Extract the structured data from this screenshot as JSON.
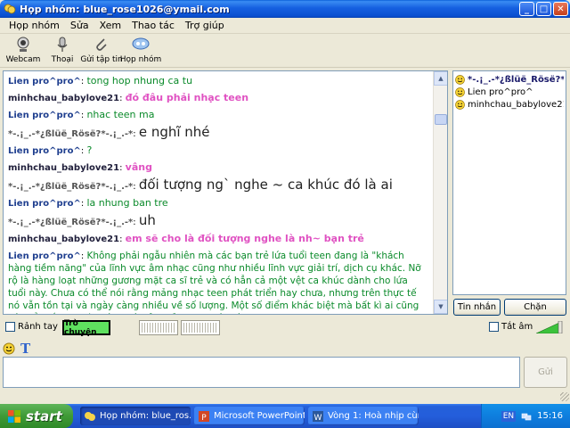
{
  "window": {
    "title_prefix": "Họp nhóm:",
    "title_email": "blue_rose1026@ymail.com"
  },
  "menu": [
    "Họp nhóm",
    "Sửa",
    "Xem",
    "Thao tác",
    "Trợ giúp"
  ],
  "toolbar": [
    {
      "label": "Webcam",
      "icon": "webcam-icon"
    },
    {
      "label": "Thoại",
      "icon": "microphone-icon"
    },
    {
      "label": "Gửi tập tin",
      "icon": "paperclip-icon"
    },
    {
      "label": "Họp nhóm",
      "icon": "conference-icon"
    }
  ],
  "chat": {
    "messages": [
      {
        "sender": "Lien pro^pro^",
        "text": "tong hop nhung ca tu",
        "style": "green",
        "skin": "lien"
      },
      {
        "sender": "minhchau_babylove21",
        "text": "đó đâu phải nhạc teen",
        "style": "pink",
        "skin": "minh"
      },
      {
        "sender": "Lien pro^pro^",
        "text": "nhac teen ma",
        "style": "green",
        "skin": "lien"
      },
      {
        "sender": "*-.¡_.-*¿ßlüë_Rösë?*-.¡_.-*",
        "text": "e nghĩ nhé",
        "style": "big",
        "skin": "rose"
      },
      {
        "sender": "Lien pro^pro^",
        "text": "?",
        "style": "green",
        "skin": "lien"
      },
      {
        "sender": "minhchau_babylove21",
        "text": "vâng",
        "style": "pink",
        "skin": "minh"
      },
      {
        "sender": "*-.¡_.-*¿ßlüë_Rösë?*-.¡_.-*",
        "text": "đối tượng ng` nghe ~ ca khúc đó là ai",
        "style": "big",
        "skin": "rose"
      },
      {
        "sender": "Lien pro^pro^",
        "text": "la nhung ban tre",
        "style": "green",
        "skin": "lien"
      },
      {
        "sender": "*-.¡_.-*¿ßlüë_Rösë?*-.¡_.-*",
        "text": "uh",
        "style": "big",
        "skin": "rose"
      },
      {
        "sender": "minhchau_babylove21",
        "text": "em sẽ cho là đối tượng nghe là nh~ bạn trẻ",
        "style": "pink",
        "skin": "minh"
      },
      {
        "sender": "Lien pro^pro^",
        "text": "Không phải ngẫu nhiên mà các bạn trẻ lứa tuổi teen đang là \"khách hàng tiềm năng\" của lĩnh vực âm nhạc cũng như nhiều lĩnh vực giải trí, dịch cụ khác. Nỡ rộ là hàng loạt những gương mặt ca sĩ trẻ và có hẳn cả một vệt ca khúc dành cho lứa tuổi này. Chưa có thể nói rằng mảng nhạc teen phát triển hay chưa, nhưng trên thực tế nó vẫn tồn tại và ngày càng nhiều về số lượng. Một số điểm khác biệt mà bất kì ai cũng có thể thấy rõ chính là ca từ của mảng ca khúc này.",
        "style": "long",
        "skin": "lien"
      }
    ]
  },
  "participants": [
    {
      "name": "*-.¡_.-*¿ßlüë_Rösë?*-.¡_.-*",
      "selected": true
    },
    {
      "name": "Lien pro^pro^",
      "selected": false
    },
    {
      "name": "minhchau_babylove21",
      "selected": false
    }
  ],
  "buttons": {
    "message": "Tin nhắn",
    "block": "Chặn",
    "send": "Gửi"
  },
  "status": {
    "busy_label": "Rảnh tay",
    "talk_badge": "Trò chuyện",
    "mute_label": "Tắt âm"
  },
  "taskbar": {
    "start": "start",
    "tasks": [
      {
        "label": "Họp nhóm: blue_ros...",
        "active": true,
        "icon": "messenger-icon"
      },
      {
        "label": "Microsoft PowerPoint ...",
        "active": false,
        "icon": "powerpoint-icon"
      },
      {
        "label": "Vòng 1: Hoà nhịp cùn...",
        "active": false,
        "icon": "word-icon"
      }
    ],
    "lang": "EN",
    "clock": "15:16"
  },
  "colors": {
    "title_blue": "#1660e0",
    "sender_blue": "#1f3f8f",
    "text_green": "#0a8a2a",
    "text_pink": "#e052c2",
    "talk_badge_green": "#5fe05f",
    "taskbar_blue": "#245edb",
    "start_green": "#3f9a37"
  }
}
